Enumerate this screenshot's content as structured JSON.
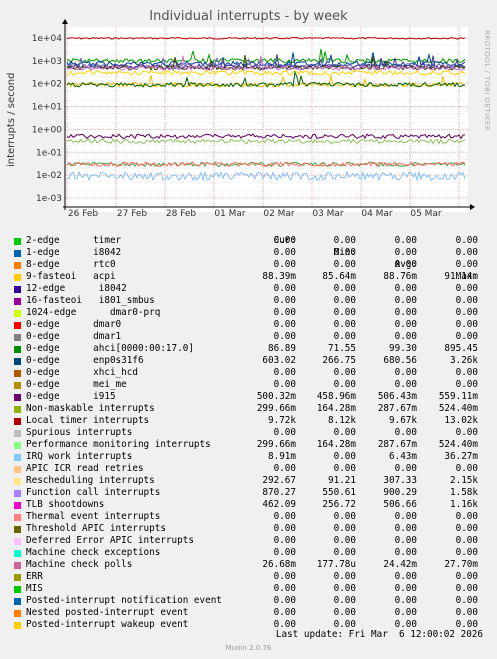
{
  "chart_data": {
    "type": "line",
    "title": "Individual interrupts - by week",
    "ylabel": "interrupts / second",
    "yscale": "log",
    "ylim": [
      0.001,
      10000
    ],
    "y_ticks": [
      "1e+04",
      "1e+03",
      "1e+02",
      "1e+01",
      "1e+00",
      "1e-01",
      "1e-02",
      "1e-03"
    ],
    "x_ticks": [
      "26 Feb",
      "27 Feb",
      "28 Feb",
      "01 Mar",
      "02 Mar",
      "03 Mar",
      "04 Mar",
      "05 Mar"
    ],
    "grid": true,
    "series_levels": [
      {
        "color": "#b00000",
        "value": 9720
      },
      {
        "color": "#00a000",
        "value": 1000
      },
      {
        "color": "#0040a0",
        "value": 750
      },
      {
        "color": "#7060c0",
        "value": 600
      },
      {
        "color": "#3a3a8a",
        "value": 550
      },
      {
        "color": "#404000",
        "value": 500
      },
      {
        "color": "#d070d0",
        "value": 480
      },
      {
        "color": "#ffd000",
        "value": 300
      },
      {
        "color": "#f0c000",
        "value": 90
      },
      {
        "color": "#006000",
        "value": 90
      },
      {
        "color": "#600060",
        "value": 0.5
      },
      {
        "color": "#90c060",
        "value": 0.3
      },
      {
        "color": "#40a040",
        "value": 0.03
      },
      {
        "color": "#ff7060",
        "value": 0.03
      },
      {
        "color": "#80c0ff",
        "value": 0.009
      }
    ]
  },
  "side_label": "RRDTOOL / TOBI OETIKER",
  "legend": {
    "headers": {
      "cur": "Cur:",
      "min": "Min:",
      "avg": "Avg:",
      "max": "Max:"
    },
    "rows": [
      {
        "name": "2-edge      timer",
        "cur": "0.00",
        "min": "0.00",
        "avg": "0.00",
        "max": "0.00",
        "color": "#00cc00"
      },
      {
        "name": "1-edge      i8042",
        "cur": "0.00",
        "min": "0.00",
        "avg": "0.00",
        "max": "0.00",
        "color": "#0066b3"
      },
      {
        "name": "8-edge      rtc0",
        "cur": "0.00",
        "min": "0.00",
        "avg": "0.00",
        "max": "0.00",
        "color": "#ff8000"
      },
      {
        "name": "9-fasteoi   acpi",
        "cur": "88.39m",
        "min": "85.64m",
        "avg": "88.76m",
        "max": "91.14m",
        "color": "#ffcc00"
      },
      {
        "name": "12-edge      i8042",
        "cur": "0.00",
        "min": "0.00",
        "avg": "0.00",
        "max": "0.00",
        "color": "#330099"
      },
      {
        "name": "16-fasteoi   i801_smbus",
        "cur": "0.00",
        "min": "0.00",
        "avg": "0.00",
        "max": "0.00",
        "color": "#990099"
      },
      {
        "name": "1024-edge      dmar0-prq",
        "cur": "0.00",
        "min": "0.00",
        "avg": "0.00",
        "max": "0.00",
        "color": "#ccff00"
      },
      {
        "name": "0-edge      dmar0",
        "cur": "0.00",
        "min": "0.00",
        "avg": "0.00",
        "max": "0.00",
        "color": "#ff0000"
      },
      {
        "name": "0-edge      dmar1",
        "cur": "0.00",
        "min": "0.00",
        "avg": "0.00",
        "max": "0.00",
        "color": "#808080"
      },
      {
        "name": "0-edge      ahci[0000:00:17.0]",
        "cur": "86.89",
        "min": "71.55",
        "avg": "99.30",
        "max": "895.45",
        "color": "#008f00"
      },
      {
        "name": "0-edge      enp0s31f6",
        "cur": "603.02",
        "min": "266.75",
        "avg": "680.56",
        "max": "3.26k",
        "color": "#00487d"
      },
      {
        "name": "0-edge      xhci_hcd",
        "cur": "0.00",
        "min": "0.00",
        "avg": "0.00",
        "max": "0.00",
        "color": "#b35a00"
      },
      {
        "name": "0-edge      mei_me",
        "cur": "0.00",
        "min": "0.00",
        "avg": "0.00",
        "max": "0.00",
        "color": "#b38f00"
      },
      {
        "name": "0-edge      i915",
        "cur": "500.32m",
        "min": "458.96m",
        "avg": "506.43m",
        "max": "559.11m",
        "color": "#6b006b"
      },
      {
        "name": "Non-maskable interrupts",
        "cur": "299.66m",
        "min": "164.28m",
        "avg": "287.67m",
        "max": "524.40m",
        "color": "#8fb300"
      },
      {
        "name": "Local timer interrupts",
        "cur": "9.72k",
        "min": "8.12k",
        "avg": "9.67k",
        "max": "13.02k",
        "color": "#b30000"
      },
      {
        "name": "Spurious interrupts",
        "cur": "0.00",
        "min": "0.00",
        "avg": "0.00",
        "max": "0.00",
        "color": "#bebebe"
      },
      {
        "name": "Performance monitoring interrupts",
        "cur": "299.66m",
        "min": "164.28m",
        "avg": "287.67m",
        "max": "524.40m",
        "color": "#80ff80"
      },
      {
        "name": "IRQ work interrupts",
        "cur": "8.91m",
        "min": "0.00",
        "avg": "6.43m",
        "max": "36.27m",
        "color": "#80c9ff"
      },
      {
        "name": "APIC ICR read retries",
        "cur": "0.00",
        "min": "0.00",
        "avg": "0.00",
        "max": "0.00",
        "color": "#ffc080"
      },
      {
        "name": "Rescheduling interrupts",
        "cur": "292.67",
        "min": "91.21",
        "avg": "307.33",
        "max": "2.15k",
        "color": "#ffe680"
      },
      {
        "name": "Function call interrupts",
        "cur": "870.27",
        "min": "550.61",
        "avg": "900.29",
        "max": "1.58k",
        "color": "#aa80ff"
      },
      {
        "name": "TLB shootdowns",
        "cur": "462.09",
        "min": "256.72",
        "avg": "506.66",
        "max": "1.16k",
        "color": "#ee00cc"
      },
      {
        "name": "Thermal event interrupts",
        "cur": "0.00",
        "min": "0.00",
        "avg": "0.00",
        "max": "0.00",
        "color": "#ff8080"
      },
      {
        "name": "Threshold APIC interrupts",
        "cur": "0.00",
        "min": "0.00",
        "avg": "0.00",
        "max": "0.00",
        "color": "#666600"
      },
      {
        "name": "Deferred Error APIC interrupts",
        "cur": "0.00",
        "min": "0.00",
        "avg": "0.00",
        "max": "0.00",
        "color": "#ffbfff"
      },
      {
        "name": "Machine check exceptions",
        "cur": "0.00",
        "min": "0.00",
        "avg": "0.00",
        "max": "0.00",
        "color": "#00ffcc"
      },
      {
        "name": "Machine check polls",
        "cur": "26.68m",
        "min": "177.78u",
        "avg": "24.42m",
        "max": "27.70m",
        "color": "#cc6699"
      },
      {
        "name": "ERR",
        "cur": "0.00",
        "min": "0.00",
        "avg": "0.00",
        "max": "0.00",
        "color": "#999900"
      },
      {
        "name": "MIS",
        "cur": "0.00",
        "min": "0.00",
        "avg": "0.00",
        "max": "0.00",
        "color": "#00cc00"
      },
      {
        "name": "Posted-interrupt notification event",
        "cur": "0.00",
        "min": "0.00",
        "avg": "0.00",
        "max": "0.00",
        "color": "#0066b3"
      },
      {
        "name": "Nested posted-interrupt event",
        "cur": "0.00",
        "min": "0.00",
        "avg": "0.00",
        "max": "0.00",
        "color": "#ff8000"
      },
      {
        "name": "Posted-interrupt wakeup event",
        "cur": "0.00",
        "min": "0.00",
        "avg": "0.00",
        "max": "0.00",
        "color": "#ffcc00"
      }
    ]
  },
  "last_update": "Last update: Fri Mar  6 12:00:02 2026",
  "footer": "Munin 2.0.76"
}
